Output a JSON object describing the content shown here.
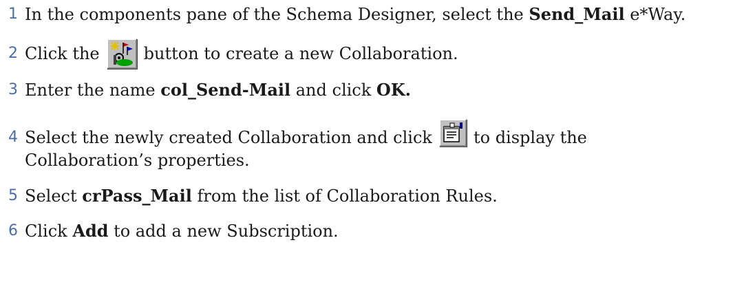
{
  "steps": [
    {
      "num": "1",
      "pre": "In the components pane of the Schema Designer, select the ",
      "bold": "Send_Mail",
      "post": " e*Way."
    },
    {
      "num": "2",
      "pre": "Click the",
      "icon": "new-collaboration-icon",
      "post": "button to create a new Collaboration."
    },
    {
      "num": "3",
      "pre": "Enter the name ",
      "bold": "col_Send-Mail",
      "mid": " and click ",
      "bold2": "OK."
    },
    {
      "num": "4",
      "pre": "Select the newly created Collaboration and click",
      "icon": "properties-icon",
      "post": "to display the",
      "line2": "Collaboration’s properties."
    },
    {
      "num": "5",
      "pre": "Select ",
      "bold": "crPass_Mail",
      "post": " from the list of Collaboration Rules."
    },
    {
      "num": "6",
      "pre": "Click ",
      "bold": "Add",
      "post": " to add a new Subscription."
    }
  ],
  "colors": {
    "step_number": "#4a6fa5",
    "text": "#1a1a1a",
    "button_face": "#c0c0c0"
  }
}
